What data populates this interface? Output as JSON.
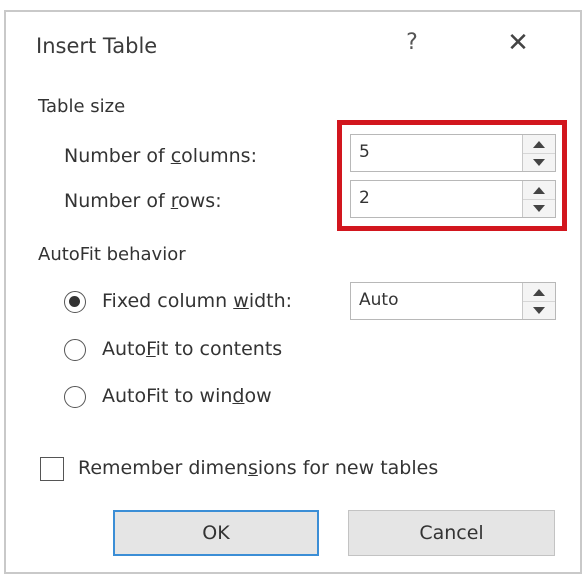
{
  "dialog": {
    "title": "Insert Table",
    "help_label": "?",
    "close_label": "✕"
  },
  "table_size": {
    "label": "Table size",
    "columns": {
      "label_pre": "Number of ",
      "label_key": "c",
      "label_post": "olumns:",
      "value": "5"
    },
    "rows": {
      "label_pre": "Number of ",
      "label_key": "r",
      "label_post": "ows:",
      "value": "2"
    }
  },
  "autofit": {
    "label": "AutoFit behavior",
    "fixed": {
      "label_pre": "Fixed column ",
      "label_key": "w",
      "label_post": "idth:",
      "selected": true,
      "value": "Auto"
    },
    "contents": {
      "label_pre": "Auto",
      "label_key": "F",
      "label_post": "it to contents",
      "selected": false
    },
    "window": {
      "label_pre": "AutoFit to win",
      "label_key": "d",
      "label_post": "ow",
      "selected": false
    }
  },
  "remember": {
    "label_pre": "Remember dimen",
    "label_key": "s",
    "label_post": "ions for new tables",
    "checked": false
  },
  "buttons": {
    "ok": "OK",
    "cancel": "Cancel"
  },
  "highlight_color": "#d2161e"
}
